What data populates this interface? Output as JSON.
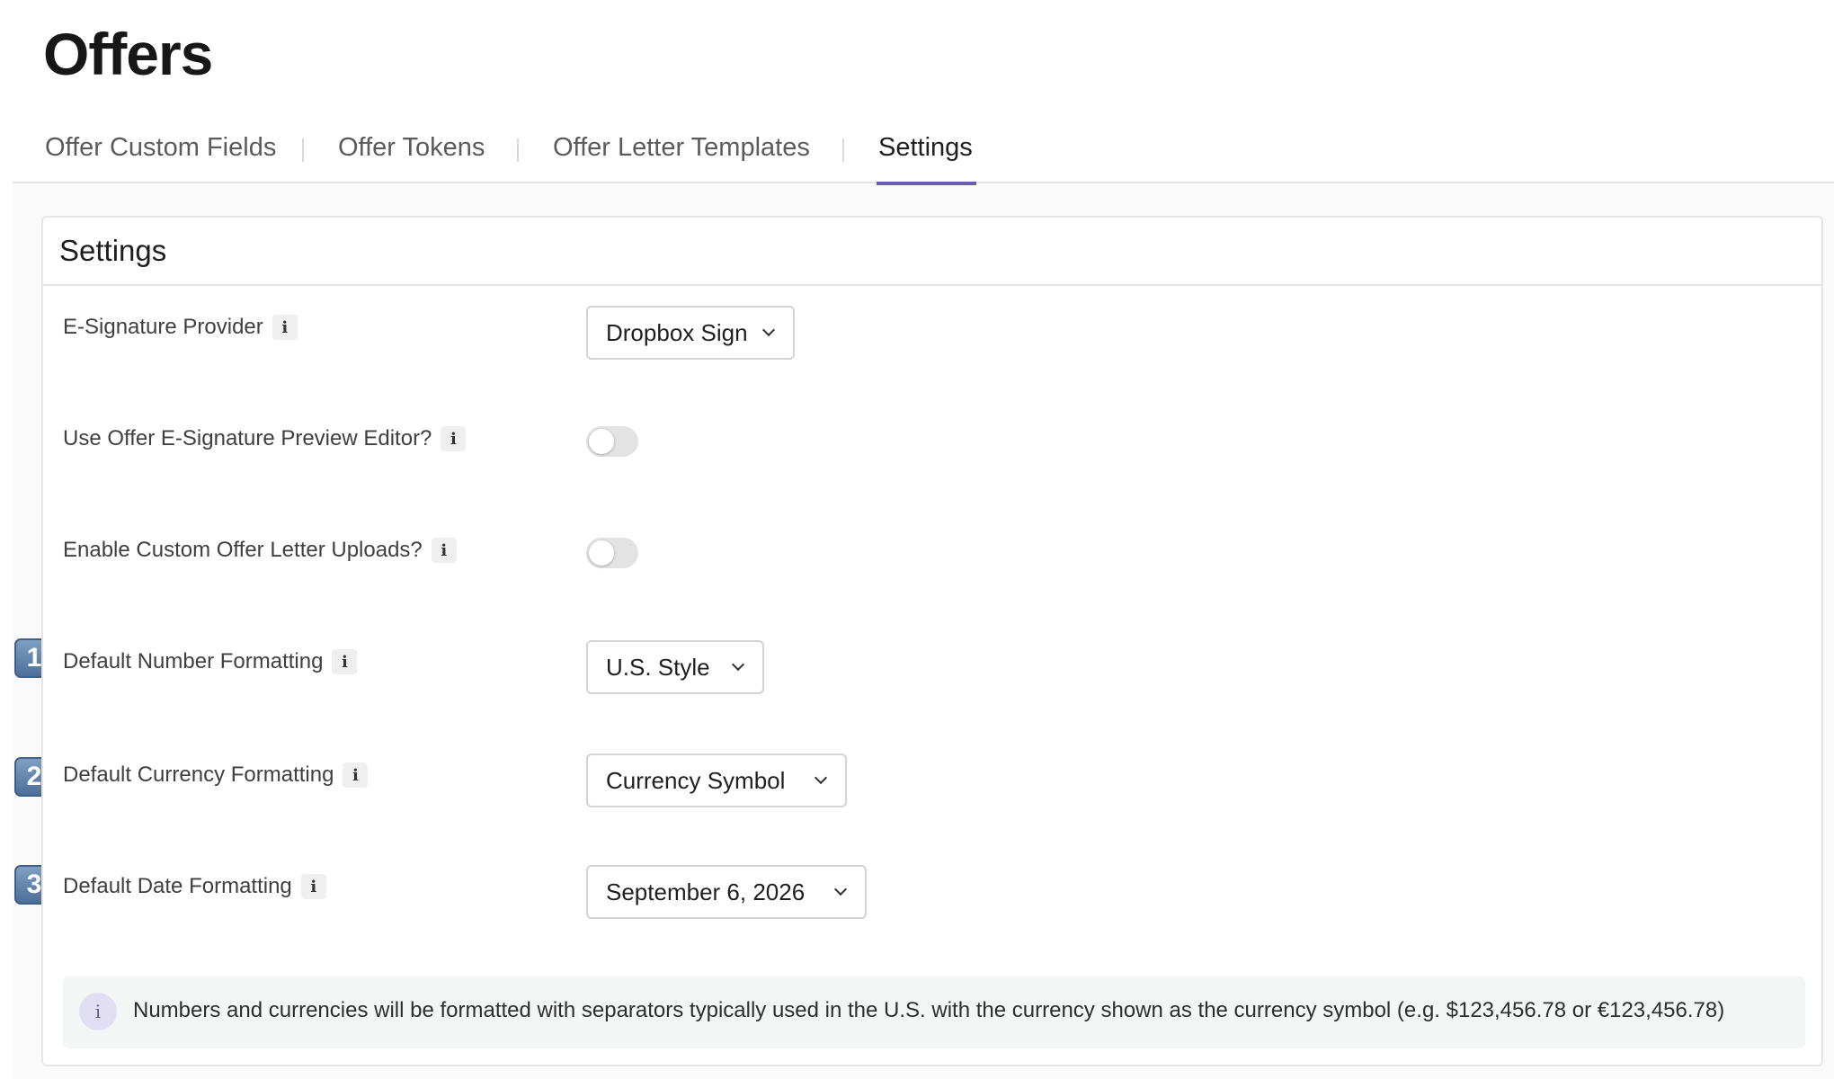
{
  "page": {
    "title": "Offers"
  },
  "tabs": [
    {
      "label": "Offer Custom Fields"
    },
    {
      "label": "Offer Tokens"
    },
    {
      "label": "Offer Letter Templates"
    },
    {
      "label": "Settings",
      "active": true
    }
  ],
  "settings": {
    "title": "Settings",
    "rows": [
      {
        "label": "E-Signature Provider",
        "control": "select",
        "value": "Dropbox Sign"
      },
      {
        "label": "Use Offer E-Signature Preview Editor?",
        "control": "toggle",
        "enabled": false
      },
      {
        "label": "Enable Custom Offer Letter Uploads?",
        "control": "toggle",
        "enabled": false
      },
      {
        "label": "Default Number Formatting",
        "control": "select",
        "value": "U.S. Style",
        "step": "1"
      },
      {
        "label": "Default Currency Formatting",
        "control": "select",
        "value": "Currency Symbol",
        "step": "2"
      },
      {
        "label": "Default Date Formatting",
        "control": "select",
        "value": "September 6, 2026",
        "step": "3"
      }
    ],
    "info_glyph": "i",
    "banner": {
      "icon": "info-icon",
      "text": "Numbers and currencies will be formatted with separators typically used in the U.S. with the currency shown as the currency symbol (e.g. $123,456.78 or €123,456.78)"
    }
  },
  "colors": {
    "accent": "#6b5bb5",
    "step_badge": "#5a7ca6",
    "banner_bg": "#f4f6f6"
  }
}
